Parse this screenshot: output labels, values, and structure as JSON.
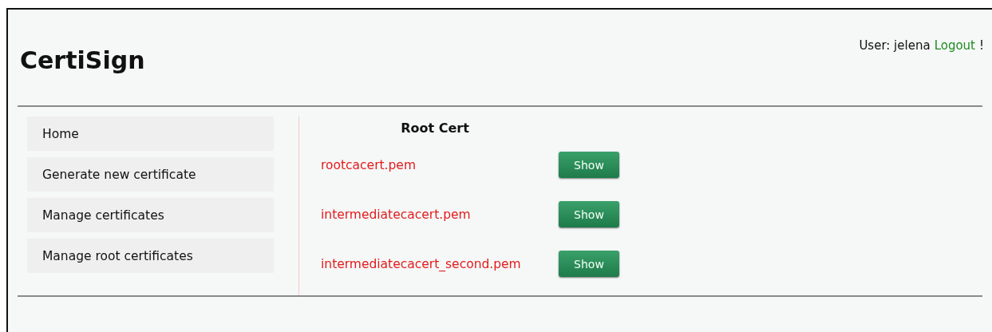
{
  "header": {
    "title": "CertiSign",
    "user_label": "User: jelena",
    "logout_link": "Logout",
    "trailing_mark": "!"
  },
  "sidebar": {
    "items": [
      {
        "label": "Home"
      },
      {
        "label": "Generate new certificate"
      },
      {
        "label": "Manage certificates"
      },
      {
        "label": "Manage root certificates"
      }
    ]
  },
  "content": {
    "heading": "Root Cert",
    "certificates": [
      {
        "file": "rootcacert.pem",
        "button": "Show"
      },
      {
        "file": "intermediatecacert.pem",
        "button": "Show"
      },
      {
        "file": "intermediatecacert_second.pem",
        "button": "Show"
      }
    ]
  }
}
